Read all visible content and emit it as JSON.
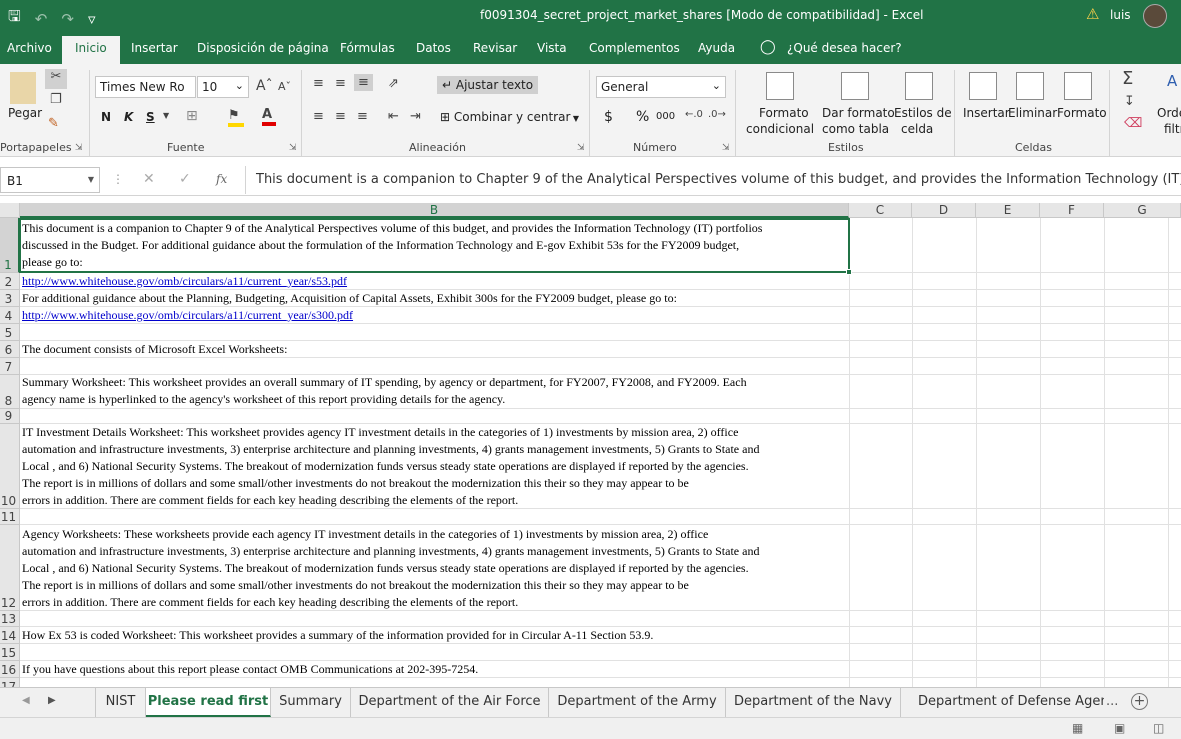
{
  "titlebar": {
    "title": "f0091304_secret_project_market_shares  [Modo de compatibilidad]  -  Excel",
    "user": "luis",
    "icons": [
      "save-icon",
      "undo-icon",
      "redo-icon",
      "customize-qat-icon",
      "warning-icon",
      "avatar"
    ]
  },
  "menu": {
    "tabs": [
      "Archivo",
      "Inicio",
      "Insertar",
      "Disposición de página",
      "Fórmulas",
      "Datos",
      "Revisar",
      "Vista",
      "Complementos",
      "Ayuda"
    ],
    "active": "Inicio",
    "tell_me": "¿Qué desea hacer?"
  },
  "ribbon": {
    "clipboard": {
      "paste": "Pegar",
      "label": "Portapapeles"
    },
    "font": {
      "name": "Times New Ro",
      "size": "10",
      "bold": "N",
      "italic": "K",
      "underline": "S",
      "label": "Fuente",
      "font_color": "#e00000",
      "fill_color": "#ffd700"
    },
    "alignment": {
      "wrap": "Ajustar texto",
      "merge": "Combinar y centrar",
      "label": "Alineación"
    },
    "number": {
      "format": "General",
      "currency": "$",
      "percent": "%",
      "thousands": "000",
      "label": "Número"
    },
    "styles": {
      "conditional": "Formato",
      "conditional2": "condicional",
      "as_table": "Dar formato",
      "as_table2": "como tabla",
      "cell_styles": "Estilos de",
      "cell_styles2": "celda",
      "label": "Estilos"
    },
    "cells": {
      "insert": "Insertar",
      "delete": "Eliminar",
      "format": "Formato",
      "label": "Celdas"
    },
    "editing": {
      "sort": "Orde",
      "sort2": "filtr"
    }
  },
  "formula_bar": {
    "name_box": "B1",
    "fx": "fx",
    "content": "This document is a companion to Chapter 9 of the Analytical Perspectives volume of this budget, and provides the Information Technology (IT) portfoli"
  },
  "grid": {
    "columns": [
      "B",
      "C",
      "D",
      "E",
      "F",
      "G"
    ],
    "selected_cell": "B1",
    "rows": [
      {
        "num": "1",
        "text": "This document is a companion to Chapter 9 of the Analytical Perspectives volume of this budget, and provides the Information Technology (IT) portfolios\ndiscussed in the Budget.  For additional guidance about the formulation of the Information Technology and E-gov Exhibit 53s for the FY2009 budget,\nplease go to:"
      },
      {
        "num": "2",
        "text": "http://www.whitehouse.gov/omb/circulars/a11/current_year/s53.pdf",
        "link": true
      },
      {
        "num": "3",
        "text": "For additional guidance about the Planning, Budgeting, Acquisition of Capital Assets,  Exhibit 300s for the FY2009 budget, please go to:"
      },
      {
        "num": "4",
        "text": "http://www.whitehouse.gov/omb/circulars/a11/current_year/s300.pdf",
        "link": true
      },
      {
        "num": "5",
        "text": ""
      },
      {
        "num": "6",
        "text": "The document consists of  Microsoft Excel Worksheets:"
      },
      {
        "num": "7",
        "text": ""
      },
      {
        "num": "8",
        "text": "Summary Worksheet:  This worksheet provides an overall summary of IT spending, by agency or department, for FY2007, FY2008, and FY2009.  Each\nagency name is hyperlinked to the agency's worksheet of this report providing details for the agency."
      },
      {
        "num": "9",
        "text": ""
      },
      {
        "num": "10",
        "text": "IT Investment Details Worksheet:  This worksheet provides agency IT investment details in the categories of 1) investments by mission area, 2) office\nautomation and infrastructure investments, 3) enterprise architecture and planning investments, 4) grants management investments, 5) Grants to State and\nLocal , and 6) National Security Systems.  The breakout of modernization funds versus steady state operations are displayed if reported by the agencies.\nThe report is in millions of dollars and some small/other investments do not breakout the modernization this their so they may appear to be\nerrors in addition.  There are comment fields for each key heading describing the elements of the report."
      },
      {
        "num": "11",
        "text": ""
      },
      {
        "num": "12",
        "text": "Agency Worksheets:  These worksheets provide each agency IT investment details in the categories of 1) investments by mission area, 2) office\nautomation and infrastructure investments, 3) enterprise architecture and planning investments, 4) grants management investments, 5) Grants to State and\nLocal , and 6) National Security Systems.  The breakout of modernization funds versus steady state operations are displayed if reported by the agencies.\nThe report is in millions of dollars and some small/other investments do not breakout the modernization this their so they may appear to be\nerrors in addition.  There are comment fields for each key heading describing the elements of the report."
      },
      {
        "num": "13",
        "text": ""
      },
      {
        "num": "14",
        "text": "How Ex 53 is coded Worksheet: This worksheet provides a summary of the information provided for in Circular A-11 Section 53.9."
      },
      {
        "num": "15",
        "text": ""
      },
      {
        "num": "16",
        "text": "If you have questions about this report please contact OMB Communications at 202-395-7254."
      },
      {
        "num": "17",
        "text": ""
      }
    ]
  },
  "sheets": {
    "tabs": [
      "NIST",
      "Please read first",
      "Summary",
      "Department of the Air Force",
      "Department of the Army",
      "Department of the Navy",
      "Department of Defense Agenci"
    ],
    "active": "Please read first",
    "more": "...",
    "add": "+"
  },
  "statusbar": {
    "views": [
      "normal-view-icon",
      "page-layout-icon",
      "page-break-icon"
    ]
  },
  "colors": {
    "excel_green": "#217346"
  }
}
